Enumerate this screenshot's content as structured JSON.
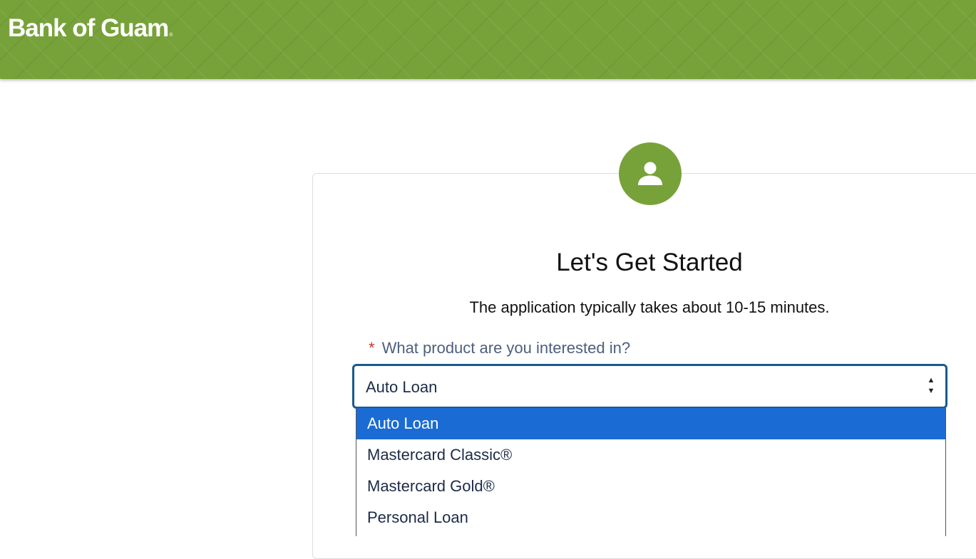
{
  "header": {
    "logo_text": "Bank of Guam",
    "logo_mark": "®",
    "brand_color": "#77a23a"
  },
  "intro": {
    "avatar_icon": "user-icon",
    "title": "Let's Get Started",
    "subtitle": "The application typically takes about 10-15 minutes."
  },
  "form": {
    "product": {
      "required_marker": "*",
      "label": "What product are you interested in?",
      "selected_value": "Auto Loan",
      "options": [
        {
          "label": "Auto Loan",
          "highlighted": true
        },
        {
          "label": "Mastercard Classic®",
          "highlighted": false
        },
        {
          "label": "Mastercard Gold®",
          "highlighted": false
        },
        {
          "label": "Personal Loan",
          "highlighted": false
        }
      ]
    }
  },
  "colors": {
    "accent": "#77a23a",
    "select_border": "#1a5b8e",
    "option_highlight": "#1b6bd4",
    "label_text": "#4d5f7d",
    "required": "#c0392b"
  }
}
